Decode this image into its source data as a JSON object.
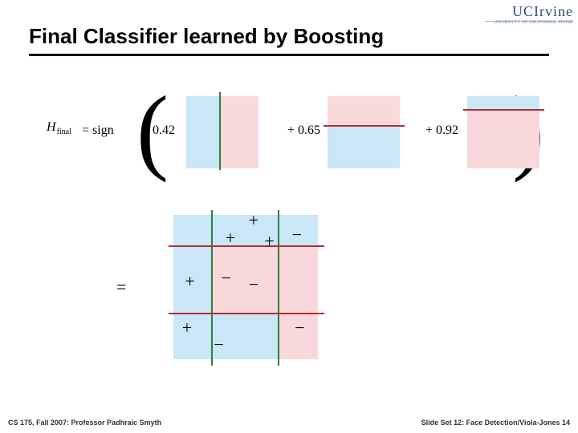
{
  "logo": {
    "main": "UCIrvine",
    "sub": "UNIVERSITY OF CALIFORNIA, IRVINE"
  },
  "title": "Final Classifier learned by Boosting",
  "equation": {
    "h_symbol": "H",
    "h_sub": "final",
    "sign_eq": "= sign",
    "coef1": "0.42",
    "coef2": "+ 0.65",
    "coef3": "+ 0.92",
    "paren_l": "(",
    "paren_r": ")"
  },
  "result_eq": "=",
  "symbols": {
    "p1": "+",
    "p2": "+",
    "p3": "+",
    "p4": "+",
    "p5": "+",
    "p6": "+",
    "m1": "−",
    "m2": "−",
    "m3": "−",
    "m4": "−",
    "m5": "−"
  },
  "footer": {
    "left": "CS 175, Fall 2007: Professor Padhraic Smyth",
    "right": "Slide Set 12: Face Detection/Viola-Jones 14"
  }
}
